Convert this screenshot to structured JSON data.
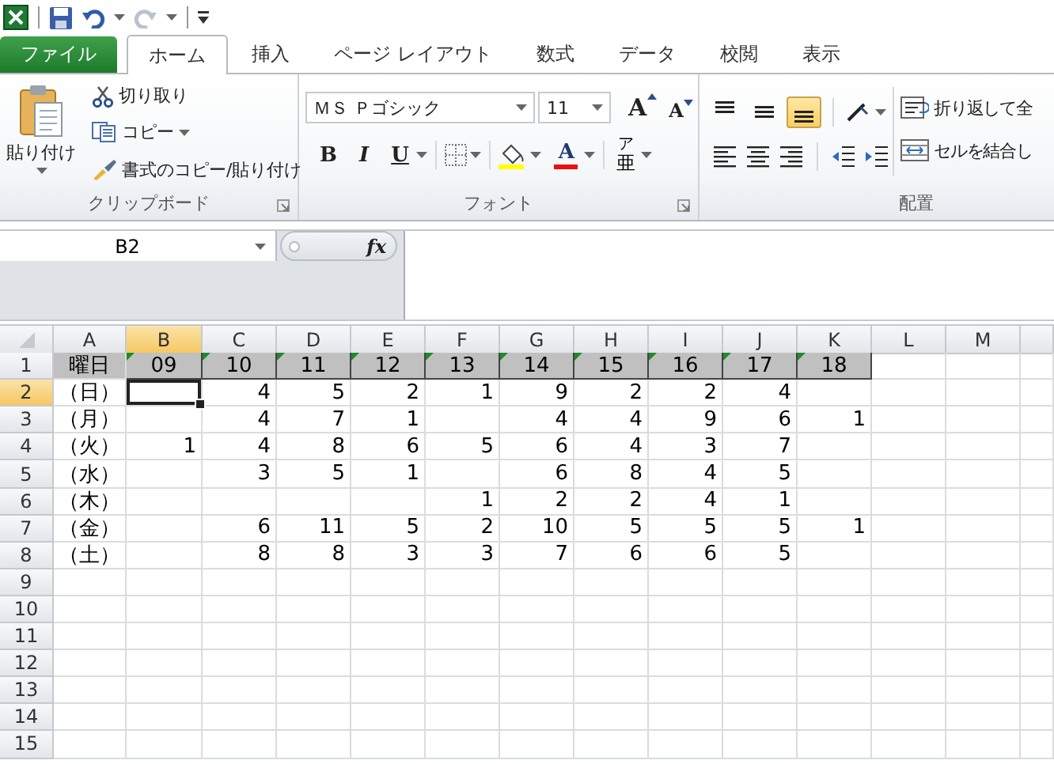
{
  "tabs": [
    {
      "label": "ファイル",
      "kind": "file",
      "selected": false
    },
    {
      "label": "ホーム",
      "kind": "tab",
      "selected": true
    },
    {
      "label": "挿入",
      "kind": "tab",
      "selected": false
    },
    {
      "label": "ページ レイアウト",
      "kind": "tab",
      "selected": false
    },
    {
      "label": "数式",
      "kind": "tab",
      "selected": false
    },
    {
      "label": "データ",
      "kind": "tab",
      "selected": false
    },
    {
      "label": "校閲",
      "kind": "tab",
      "selected": false
    },
    {
      "label": "表示",
      "kind": "tab",
      "selected": false
    }
  ],
  "clipboard": {
    "label": "クリップボード",
    "paste": "貼り付け",
    "cut": "切り取り",
    "copy": "コピー",
    "format_painter": "書式のコピー/貼り付け"
  },
  "font": {
    "label": "フォント",
    "font_name": "ＭＳ Ｐゴシック",
    "font_size": "11",
    "grow": "A",
    "shrink": "A",
    "bold": "B",
    "italic": "I",
    "underline": "U",
    "font_color": "A",
    "phonetic_top": "ア",
    "phonetic": "亜"
  },
  "alignment": {
    "label": "配置",
    "vertical": [
      {
        "kind": "top",
        "selected": false
      },
      {
        "kind": "middle",
        "selected": false
      },
      {
        "kind": "bottom",
        "selected": true
      }
    ],
    "wrap_text": "折り返して全",
    "merge": "セルを結合し"
  },
  "formula_bar": {
    "name_box": "B2",
    "fx": "fx"
  },
  "sheet": {
    "columns": [
      {
        "label": "A",
        "selected": false
      },
      {
        "label": "B",
        "selected": true
      },
      {
        "label": "C",
        "selected": false
      },
      {
        "label": "D",
        "selected": false
      },
      {
        "label": "E",
        "selected": false
      },
      {
        "label": "F",
        "selected": false
      },
      {
        "label": "G",
        "selected": false
      },
      {
        "label": "H",
        "selected": false
      },
      {
        "label": "I",
        "selected": false
      },
      {
        "label": "J",
        "selected": false
      },
      {
        "label": "K",
        "selected": false
      },
      {
        "label": "L",
        "selected": false
      },
      {
        "label": "M",
        "selected": false
      }
    ],
    "rows": [
      {
        "label": "1",
        "selected": false,
        "kind": "header",
        "cells": [
          "曜日",
          "09",
          "10",
          "11",
          "12",
          "13",
          "14",
          "15",
          "16",
          "17",
          "18",
          null,
          null
        ]
      },
      {
        "label": "2",
        "selected": true,
        "kind": "data",
        "cells": [
          "（日）",
          null,
          "4",
          "5",
          "2",
          "1",
          "9",
          "2",
          "2",
          "4",
          null,
          null,
          null
        ]
      },
      {
        "label": "3",
        "selected": false,
        "kind": "data",
        "cells": [
          "（月）",
          null,
          "4",
          "7",
          "1",
          null,
          "4",
          "4",
          "9",
          "6",
          "1",
          null,
          null
        ]
      },
      {
        "label": "4",
        "selected": false,
        "kind": "data",
        "cells": [
          "（火）",
          "1",
          "4",
          "8",
          "6",
          "5",
          "6",
          "4",
          "3",
          "7",
          null,
          null,
          null
        ]
      },
      {
        "label": "5",
        "selected": false,
        "kind": "data",
        "cells": [
          "（水）",
          null,
          "3",
          "5",
          "1",
          null,
          "6",
          "8",
          "4",
          "5",
          null,
          null,
          null
        ]
      },
      {
        "label": "6",
        "selected": false,
        "kind": "data",
        "cells": [
          "（木）",
          null,
          null,
          null,
          null,
          "1",
          "2",
          "2",
          "4",
          "1",
          null,
          null,
          null
        ]
      },
      {
        "label": "7",
        "selected": false,
        "kind": "data",
        "cells": [
          "（金）",
          null,
          "6",
          "11",
          "5",
          "2",
          "10",
          "5",
          "5",
          "5",
          "1",
          null,
          null
        ]
      },
      {
        "label": "8",
        "selected": false,
        "kind": "data",
        "cells": [
          "（土）",
          null,
          "8",
          "8",
          "3",
          "3",
          "7",
          "6",
          "6",
          "5",
          null,
          null,
          null
        ]
      },
      {
        "label": "9",
        "selected": false,
        "kind": "data",
        "cells": []
      },
      {
        "label": "10",
        "selected": false,
        "kind": "data",
        "cells": []
      },
      {
        "label": "11",
        "selected": false,
        "kind": "data",
        "cells": []
      },
      {
        "label": "12",
        "selected": false,
        "kind": "data",
        "cells": []
      },
      {
        "label": "13",
        "selected": false,
        "kind": "data",
        "cells": []
      },
      {
        "label": "14",
        "selected": false,
        "kind": "data",
        "cells": []
      },
      {
        "label": "15",
        "selected": false,
        "kind": "data",
        "cells": []
      }
    ]
  }
}
